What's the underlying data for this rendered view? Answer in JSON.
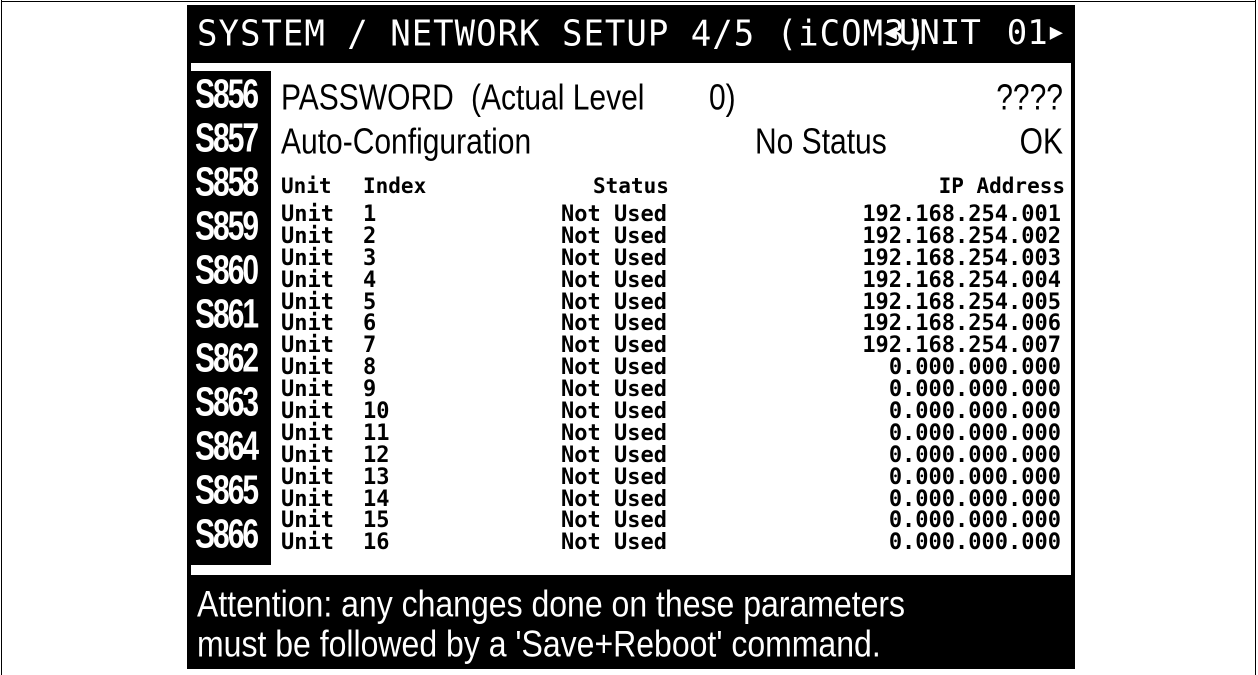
{
  "header": {
    "title": "SYSTEM / NETWORK SETUP 4/5 (iCOM3)",
    "unit_label": "UNIT",
    "unit_number": "01",
    "prev_icon": "triangle-left-icon",
    "next_icon": "triangle-right-icon"
  },
  "codes": [
    "S856",
    "S857",
    "S858",
    "S859",
    "S860",
    "S861",
    "S862",
    "S863",
    "S864",
    "S865",
    "S866"
  ],
  "password": {
    "label": "PASSWORD",
    "level_text": "(Actual Level",
    "level_value": "0)",
    "value": "????"
  },
  "auto_config": {
    "label": "Auto-Configuration",
    "status": "No Status",
    "action": "OK"
  },
  "table": {
    "headers": {
      "unit": "Unit",
      "index": "Index",
      "status": "Status",
      "ip": "IP Address"
    },
    "rows": [
      {
        "unit": "Unit",
        "index": "1",
        "status": "Not Used",
        "ip": "192.168.254.001"
      },
      {
        "unit": "Unit",
        "index": "2",
        "status": "Not Used",
        "ip": "192.168.254.002"
      },
      {
        "unit": "Unit",
        "index": "3",
        "status": "Not Used",
        "ip": "192.168.254.003"
      },
      {
        "unit": "Unit",
        "index": "4",
        "status": "Not Used",
        "ip": "192.168.254.004"
      },
      {
        "unit": "Unit",
        "index": "5",
        "status": "Not Used",
        "ip": "192.168.254.005"
      },
      {
        "unit": "Unit",
        "index": "6",
        "status": "Not Used",
        "ip": "192.168.254.006"
      },
      {
        "unit": "Unit",
        "index": "7",
        "status": "Not Used",
        "ip": "192.168.254.007"
      },
      {
        "unit": "Unit",
        "index": "8",
        "status": "Not Used",
        "ip": "0.000.000.000"
      },
      {
        "unit": "Unit",
        "index": "9",
        "status": "Not Used",
        "ip": "0.000.000.000"
      },
      {
        "unit": "Unit",
        "index": "10",
        "status": "Not Used",
        "ip": "0.000.000.000"
      },
      {
        "unit": "Unit",
        "index": "11",
        "status": "Not Used",
        "ip": "0.000.000.000"
      },
      {
        "unit": "Unit",
        "index": "12",
        "status": "Not Used",
        "ip": "0.000.000.000"
      },
      {
        "unit": "Unit",
        "index": "13",
        "status": "Not Used",
        "ip": "0.000.000.000"
      },
      {
        "unit": "Unit",
        "index": "14",
        "status": "Not Used",
        "ip": "0.000.000.000"
      },
      {
        "unit": "Unit",
        "index": "15",
        "status": "Not Used",
        "ip": "0.000.000.000"
      },
      {
        "unit": "Unit",
        "index": "16",
        "status": "Not Used",
        "ip": "0.000.000.000"
      }
    ]
  },
  "footer": {
    "line1": "Attention: any changes done on these parameters",
    "line2": "must be followed by a 'Save+Reboot' command."
  },
  "colors": {
    "background": "#ffffff",
    "display_fg": "#000000",
    "inverse_fg": "#ffffff"
  }
}
